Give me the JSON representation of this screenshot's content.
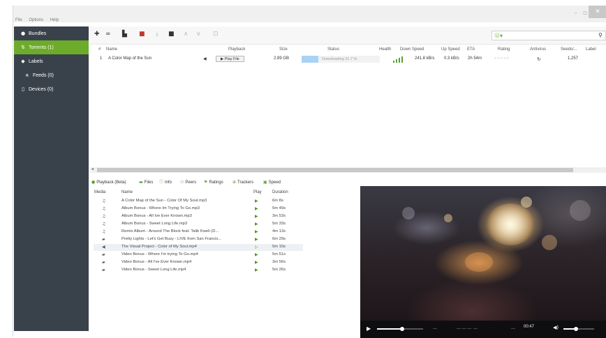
{
  "menu": [
    "File",
    "Options",
    "Help"
  ],
  "sidebar": {
    "items": [
      {
        "label": "Bundles",
        "icon": "bundles-icon"
      },
      {
        "label": "Torrents (1)",
        "icon": "torrents-icon"
      },
      {
        "label": "Labels",
        "icon": "label-tag-icon"
      },
      {
        "label": "Feeds (0)",
        "icon": "rss-icon"
      },
      {
        "label": "Devices (0)",
        "icon": "device-icon"
      }
    ]
  },
  "colors": {
    "sidebar_bg": "#39424b",
    "accent": "#6dab2b",
    "progress": "#a9d3f5"
  },
  "table": {
    "columns": [
      "#",
      "Name",
      "Playback",
      "Size",
      "Status",
      "Health",
      "Down Speed",
      "Up Speed",
      "ETA",
      "Rating",
      "Antivirus",
      "Seeds/...",
      "Label"
    ],
    "rows": [
      {
        "num": "1",
        "name": "A Color Map of the Sun",
        "playback": "▶ Play File",
        "size": "2.89 GB",
        "status": "Downloading 21.7 %",
        "progress_fraction": 0.217,
        "down": "241.8 kB/s",
        "up": "0.3 kB/s",
        "eta": "2h 54m",
        "seeds": "1,257"
      }
    ]
  },
  "tabs": [
    "Playback (Beta)",
    "Files",
    "Info",
    "Peers",
    "Ratings",
    "Trackers",
    "Speed"
  ],
  "media": {
    "columns": [
      "Media",
      "Name",
      "Play",
      "Duration"
    ],
    "rows": [
      {
        "type": "audio",
        "name": "A Color Map of the Sun - Color Of My Soul.mp3",
        "duration": "6m 8s"
      },
      {
        "type": "audio",
        "name": "Album Bonus - Where Im Trying To Go.mp3",
        "duration": "5m 49s"
      },
      {
        "type": "audio",
        "name": "Album Bonus - All Ive Ever Known.mp3",
        "duration": "3m 53s"
      },
      {
        "type": "audio",
        "name": "Album Bonus - Sweet Long Life.mp3",
        "duration": "5m 33s"
      },
      {
        "type": "audio",
        "name": "Remix Album - Around The Block feat. Talib Kweli (D...",
        "duration": "4m 13s"
      },
      {
        "type": "video",
        "name": "Pretty Lights - Let's Get Busy - LIVE from San Francis...",
        "duration": "6m 29s"
      },
      {
        "type": "playing",
        "name": "The Visual Project - Color of My Soul.mp4",
        "duration": "5m 10s"
      },
      {
        "type": "video",
        "name": "Video Bonus - Where I'm trying To Go.mp4",
        "duration": "5m 51s"
      },
      {
        "type": "video",
        "name": "Video Bonus - All I've Ever Known.mp4",
        "duration": "3m 56s"
      },
      {
        "type": "video",
        "name": "Video Bonus - Sweet Long Life.mp4",
        "duration": "5m 26s"
      }
    ]
  },
  "player": {
    "time": "00:47",
    "progress_fraction": 0.55,
    "volume_fraction": 0.4
  }
}
